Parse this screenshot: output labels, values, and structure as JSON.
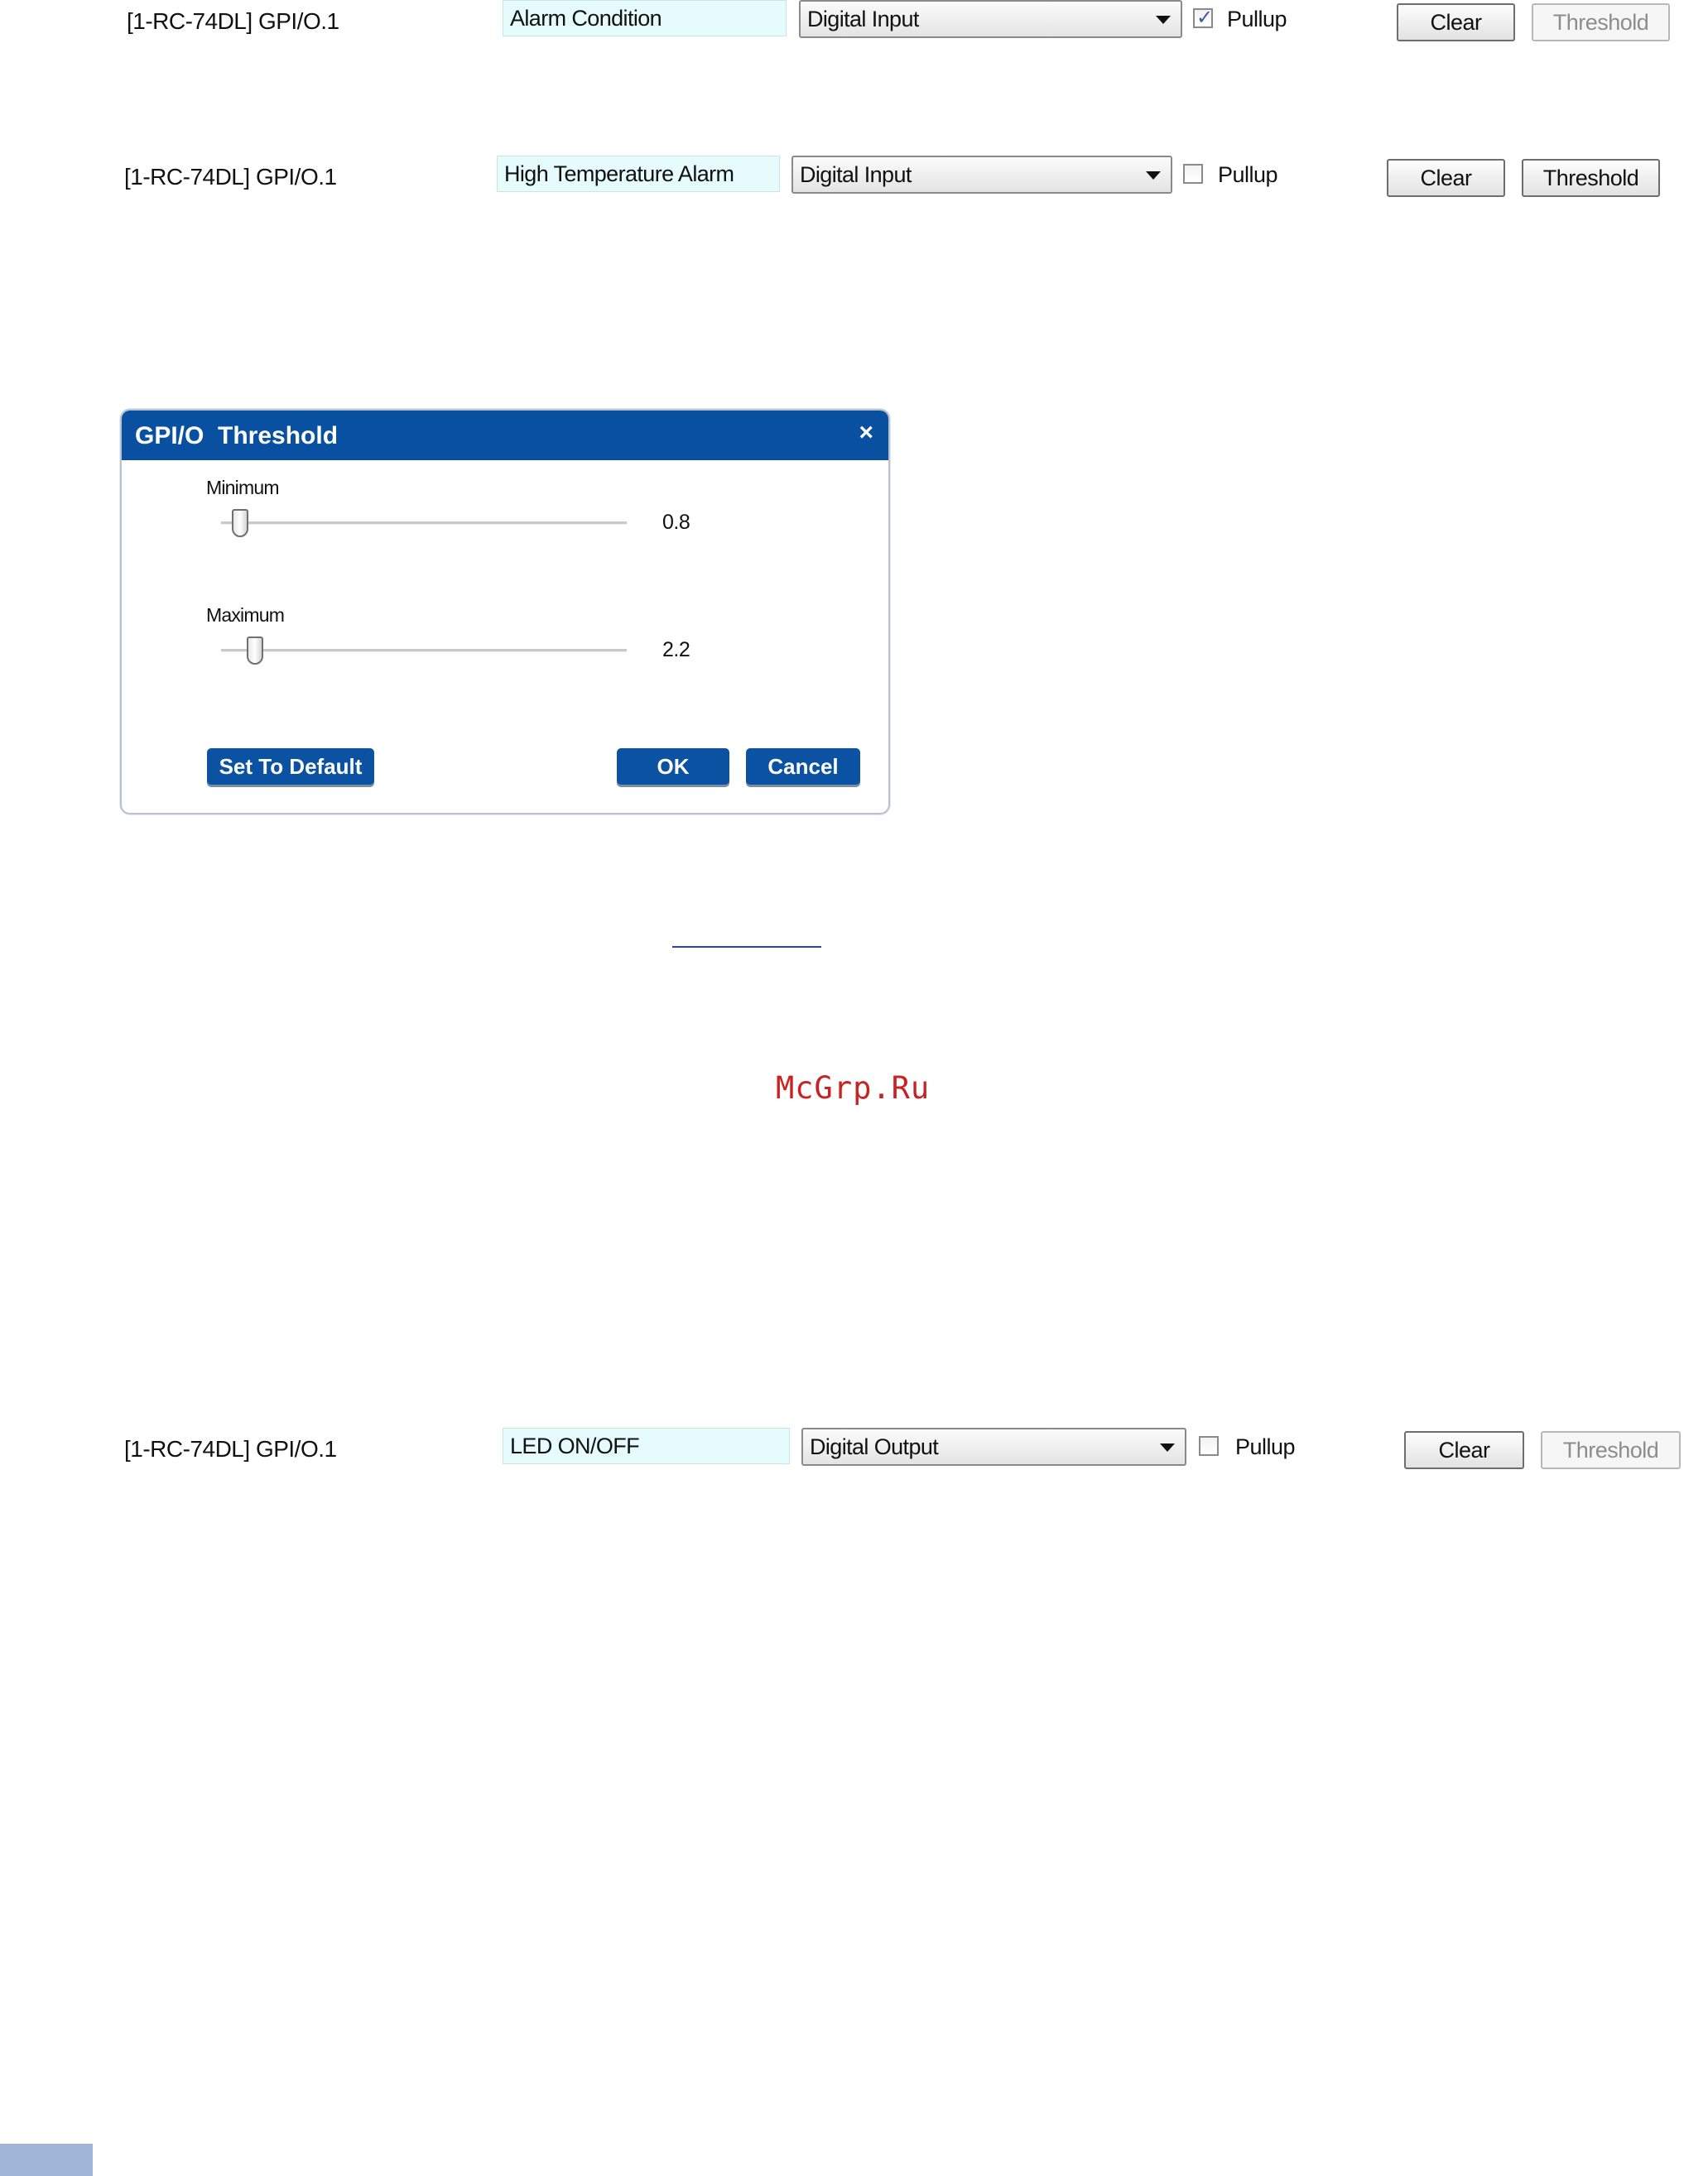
{
  "rows": [
    {
      "port": "[1-RC-74DL] GPI/O.1",
      "name": "Alarm Condition",
      "mode": "Digital Input",
      "pullup_checked": true,
      "pullup_label": "Pullup",
      "clear_label": "Clear",
      "threshold_label": "Threshold",
      "threshold_enabled": false
    },
    {
      "port": "[1-RC-74DL] GPI/O.1",
      "name": "High Temperature Alarm",
      "mode": "Digital Input",
      "pullup_checked": false,
      "pullup_label": "Pullup",
      "clear_label": "Clear",
      "threshold_label": "Threshold",
      "threshold_enabled": true
    },
    {
      "port": "[1-RC-74DL] GPI/O.1",
      "name": "LED ON/OFF",
      "mode": "Digital Output",
      "pullup_checked": false,
      "pullup_label": "Pullup",
      "clear_label": "Clear",
      "threshold_label": "Threshold",
      "threshold_enabled": false
    }
  ],
  "dialog": {
    "title": "GPI/O  Threshold",
    "close_symbol": "×",
    "minimum": {
      "label": "Minimum",
      "value": "0.8"
    },
    "maximum": {
      "label": "Maximum",
      "value": "2.2"
    },
    "set_default_label": "Set To Default",
    "ok_label": "OK",
    "cancel_label": "Cancel"
  },
  "watermark": "McGrp.Ru",
  "colors": {
    "dialog_accent": "#0a50a0",
    "name_field_bg": "#e6fcfc",
    "watermark": "#c92222",
    "page_tab": "#9fb6d8"
  },
  "icons": {
    "select_arrow": "chevron-down-icon",
    "check_mark": "check-icon",
    "close": "close-icon"
  }
}
